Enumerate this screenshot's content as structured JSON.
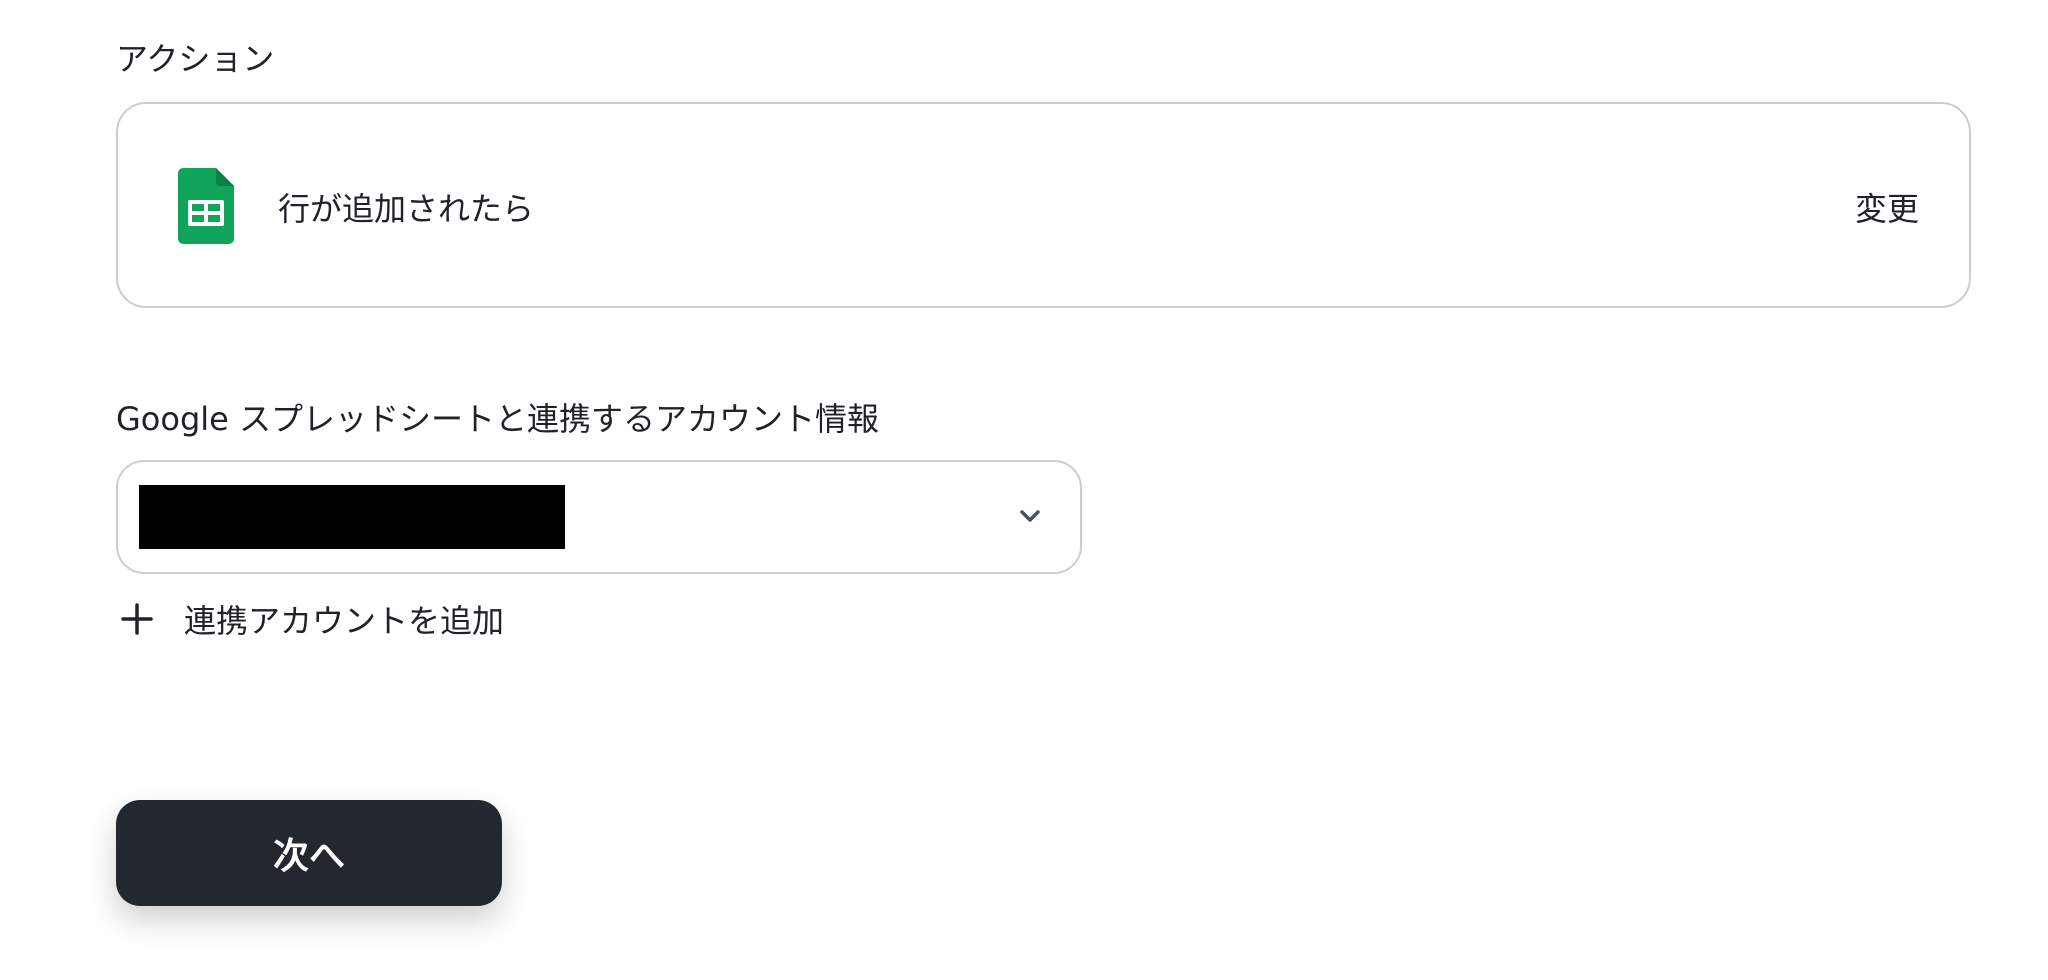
{
  "action_section": {
    "label": "アクション",
    "action_name": "行が追加されたら",
    "app_icon": "google-sheets-icon",
    "change_label": "変更"
  },
  "account_section": {
    "label": "Google スプレッドシートと連携するアカウント情報",
    "selected_account": "",
    "add_account_label": "連携アカウントを追加"
  },
  "footer": {
    "next_label": "次へ"
  },
  "colors": {
    "sheets_green": "#0f9d58",
    "primary_button": "#23272f",
    "border": "#c9ced6"
  }
}
